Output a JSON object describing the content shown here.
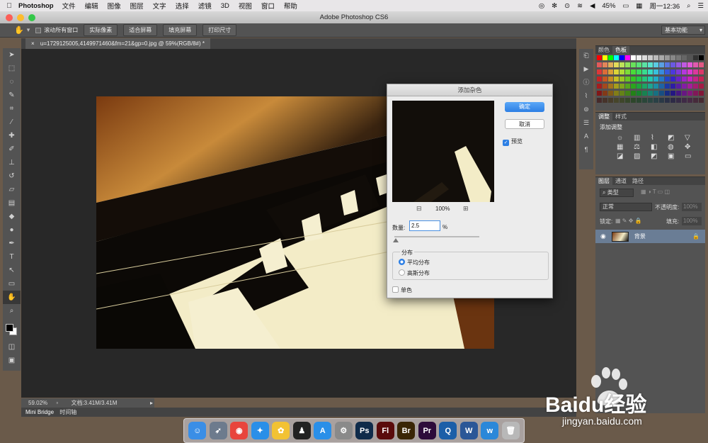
{
  "menubar": {
    "apple_icon": "apple-icon",
    "app_name": "Photoshop",
    "items": [
      "文件",
      "编辑",
      "图像",
      "图层",
      "文字",
      "选择",
      "滤镜",
      "3D",
      "视图",
      "窗口",
      "帮助"
    ],
    "battery": "45%",
    "clock": "周一12:36"
  },
  "window": {
    "title": "Adobe Photoshop CS6"
  },
  "options_bar": {
    "scroll_all_windows": "滚动所有窗口",
    "actual_pixels": "实际像素",
    "fit_screen": "适合屏幕",
    "fill_screen": "填充屏幕",
    "print_size": "打印尺寸",
    "workspace": "基本功能"
  },
  "document": {
    "tab_title": "u=1729125005,4149971460&fm=21&gp=0.jpg @ 59%(RGB/8#) *",
    "zoom": "59.02%",
    "doc_info": "文档:3.41M/3.41M"
  },
  "bottom_tabs": [
    "Mini Bridge",
    "时间轴"
  ],
  "panels": {
    "color_tabs": [
      "颜色",
      "色板"
    ],
    "adjust_tabs": [
      "调整",
      "样式"
    ],
    "adjust_title": "添加调整",
    "layers_tabs": [
      "图层",
      "通道",
      "路径"
    ],
    "layer_filter": "类型",
    "blend_mode": "正常",
    "opacity_label": "不透明度:",
    "opacity_value": "100%",
    "lock_label": "锁定:",
    "fill_label": "填充:",
    "fill_value": "100%",
    "layer_name": "背景"
  },
  "dialog": {
    "title": "添加杂色",
    "ok": "确定",
    "cancel": "取消",
    "preview_label": "预览",
    "preview_checked": true,
    "zoom": "100%",
    "amount_label": "数量:",
    "amount_value": "2.5",
    "amount_unit": "%",
    "distribution_label": "分布",
    "uniform": "平均分布",
    "gaussian": "高斯分布",
    "monochrome": "单色",
    "selected_distribution": "uniform",
    "monochrome_checked": false
  },
  "dock": [
    {
      "icon": "finder-icon",
      "color": "#3a8ee6",
      "glyph": "☺"
    },
    {
      "icon": "launchpad-icon",
      "color": "#6d7b8d",
      "glyph": "➶"
    },
    {
      "icon": "chrome-icon",
      "color": "#e8453c",
      "glyph": "◉"
    },
    {
      "icon": "safari-icon",
      "color": "#2a8fe8",
      "glyph": "✦"
    },
    {
      "icon": "photos-icon",
      "color": "#f2c233",
      "glyph": "✿"
    },
    {
      "icon": "qq-icon",
      "color": "#222222",
      "glyph": "♟"
    },
    {
      "icon": "appstore-icon",
      "color": "#2a8fe8",
      "glyph": "A"
    },
    {
      "icon": "system-preferences-icon",
      "color": "#8a8a8a",
      "glyph": "⚙"
    },
    {
      "icon": "photoshop-icon",
      "color": "#0f2b4a",
      "glyph": "Ps"
    },
    {
      "icon": "flash-icon",
      "color": "#5a0b0b",
      "glyph": "Fl"
    },
    {
      "icon": "bridge-icon",
      "color": "#3a2606",
      "glyph": "Br"
    },
    {
      "icon": "premiere-icon",
      "color": "#2d0c3a",
      "glyph": "Pr"
    },
    {
      "icon": "quicktime-icon",
      "color": "#1c5fa8",
      "glyph": "Q"
    },
    {
      "icon": "word-icon",
      "color": "#2b5797",
      "glyph": "W"
    },
    {
      "icon": "wunderlist-icon",
      "color": "#2b88d9",
      "glyph": "w"
    },
    {
      "icon": "trash-icon",
      "color": "#b8b8b8",
      "glyph": "🗑"
    }
  ],
  "watermark": {
    "brand": "Baidu经验",
    "url": "jingyan.baidu.com"
  }
}
